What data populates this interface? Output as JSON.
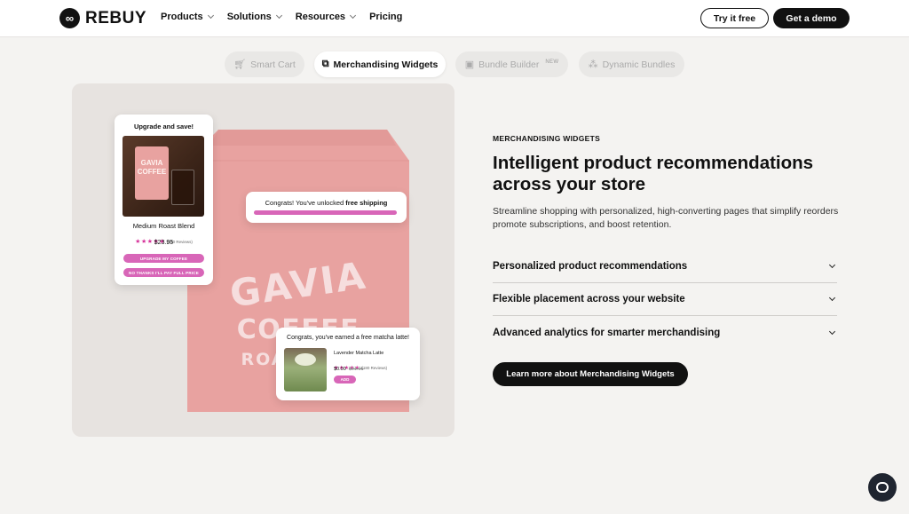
{
  "header": {
    "logo_text": "REBUY",
    "nav": [
      {
        "label": "Products",
        "has_dropdown": true
      },
      {
        "label": "Solutions",
        "has_dropdown": true
      },
      {
        "label": "Resources",
        "has_dropdown": true
      },
      {
        "label": "Pricing",
        "has_dropdown": false
      }
    ],
    "try_label": "Try it free",
    "demo_label": "Get a demo"
  },
  "tabs": [
    {
      "label": "Smart Cart",
      "icon": "cart-icon",
      "active": false
    },
    {
      "label": "Merchandising Widgets",
      "icon": "widgets-icon",
      "active": true
    },
    {
      "label": "Bundle Builder",
      "icon": "box-icon",
      "active": false,
      "badge": "NEW"
    },
    {
      "label": "Dynamic Bundles",
      "icon": "bundles-icon",
      "active": false
    }
  ],
  "hero": {
    "bag_lines": [
      "GAVIA",
      "COFFEE",
      "ROASTERS"
    ],
    "upsell_card": {
      "title": "Upgrade and save!",
      "mini_bag_lines": [
        "GAVIA",
        "COFFEE"
      ],
      "product_name": "Medium Roast Blend",
      "stars": "★★★★★",
      "reviews": "(180 Reviews)",
      "price": "$23.95",
      "primary_cta": "UPGRADE MY COFFEE",
      "secondary_cta": "NO THANKS I'LL PAY FULL PRICE"
    },
    "shipping_card": {
      "text_prefix": "Congrats! You've unlocked ",
      "text_bold": "free shipping"
    },
    "gift_card": {
      "title": "Congrats, you've earned a free matcha latte!",
      "product_name": "Lavender Matcha Latte",
      "stars": "★★★★★",
      "reviews": "(180 Reviews)",
      "price": "$0.00",
      "old_price": "$21.95",
      "add_label": "ADD"
    }
  },
  "content": {
    "eyebrow": "MERCHANDISING WIDGETS",
    "headline": "Intelligent product recommendations across your store",
    "description": "Streamline shopping with personalized, high-converting pages that simplify reorders promote subscriptions, and boost retention.",
    "accordion": [
      "Personalized product recommendations",
      "Flexible placement across your website",
      "Advanced analytics for smarter merchandising"
    ],
    "cta": "Learn more about Merchandising Widgets"
  },
  "colors": {
    "accent_pink": "#d866b8",
    "bag_pink": "#e8a2a0",
    "dark": "#111111"
  }
}
